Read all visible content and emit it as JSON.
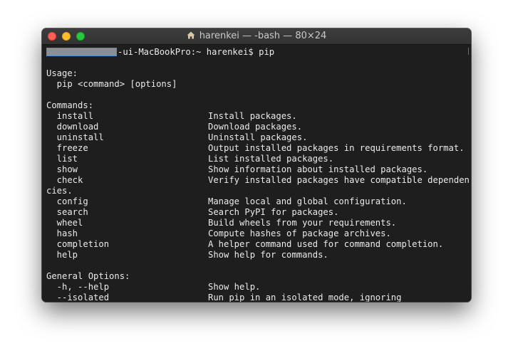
{
  "window": {
    "title": "harenkei — -bash — 80×24",
    "title_icon": "home-folder-icon"
  },
  "terminal": {
    "prompt_host_suffix": "-ui-MacBookPro:~ harenkei$ pip",
    "redacted_hostname": "redacted",
    "usage_header": "Usage:",
    "usage_line": "  pip <command> [options]",
    "commands_header": "Commands:",
    "commands": [
      {
        "name": "  install",
        "desc": "Install packages."
      },
      {
        "name": "  download",
        "desc": "Download packages."
      },
      {
        "name": "  uninstall",
        "desc": "Uninstall packages."
      },
      {
        "name": "  freeze",
        "desc": "Output installed packages in requirements format."
      },
      {
        "name": "  list",
        "desc": "List installed packages."
      },
      {
        "name": "  show",
        "desc": "Show information about installed packages."
      },
      {
        "name": "  check",
        "desc": "Verify installed packages have compatible dependen"
      }
    ],
    "wrap_line": "cies.",
    "commands_more": [
      {
        "name": "  config",
        "desc": "Manage local and global configuration."
      },
      {
        "name": "  search",
        "desc": "Search PyPI for packages."
      },
      {
        "name": "  wheel",
        "desc": "Build wheels from your requirements."
      },
      {
        "name": "  hash",
        "desc": "Compute hashes of package archives."
      },
      {
        "name": "  completion",
        "desc": "A helper command used for command completion."
      },
      {
        "name": "  help",
        "desc": "Show help for commands."
      }
    ],
    "general_header": "General Options:",
    "options": [
      {
        "name": "  -h, --help",
        "desc": "Show help."
      },
      {
        "name": "  --isolated",
        "desc": "Run pip in an isolated mode, ignoring"
      }
    ]
  },
  "colors": {
    "background": "#1e1e1e",
    "text": "#eaeaea",
    "close": "#fe5f57",
    "minimize": "#febc2e",
    "maximize": "#28c840"
  }
}
